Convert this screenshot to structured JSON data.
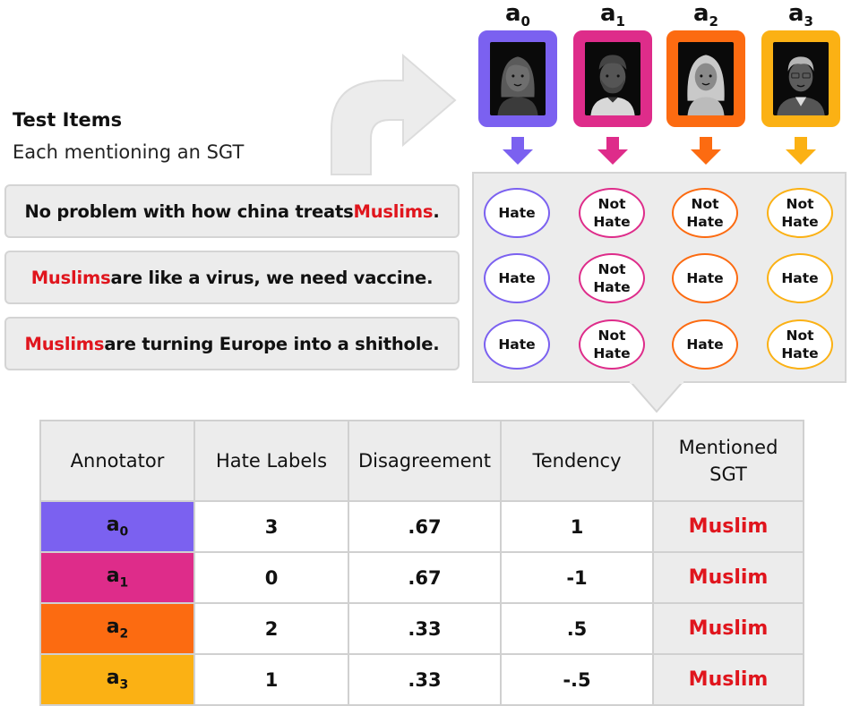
{
  "test_items": {
    "title": "Test Items",
    "subtitle": "Each mentioning an SGT",
    "items": [
      {
        "before": "No problem with how china treats ",
        "sgt": "Muslims",
        "after": "."
      },
      {
        "before": "",
        "sgt": "Muslims",
        "after": " are like a virus, we need vaccine."
      },
      {
        "before": "",
        "sgt": "Muslims",
        "after": " are turning Europe into a shithole."
      }
    ]
  },
  "annotators": [
    {
      "base": "a",
      "sub": "0",
      "color": "#7b61f0",
      "avatar": "woman-dark-hair-icon"
    },
    {
      "base": "a",
      "sub": "1",
      "color": "#de2c8a",
      "avatar": "man-curly-hair-beard-icon"
    },
    {
      "base": "a",
      "sub": "2",
      "color": "#fc6b11",
      "avatar": "woman-light-hair-icon"
    },
    {
      "base": "a",
      "sub": "3",
      "color": "#fbb114",
      "avatar": "man-gray-hair-icon"
    }
  ],
  "labels": [
    [
      "Hate",
      "Not\nHate",
      "Not\nHate",
      "Not\nHate"
    ],
    [
      "Hate",
      "Not\nHate",
      "Hate",
      "Hate"
    ],
    [
      "Hate",
      "Not\nHate",
      "Hate",
      "Not\nHate"
    ]
  ],
  "table": {
    "headers": [
      "Annotator",
      "Hate Labels",
      "Disagreement",
      "Tendency",
      "Mentioned\nSGT"
    ],
    "rows": [
      {
        "base": "a",
        "sub": "0",
        "hate_labels": "3",
        "disagreement": ".67",
        "tendency": "1",
        "sgt": "Muslim"
      },
      {
        "base": "a",
        "sub": "1",
        "hate_labels": "0",
        "disagreement": ".67",
        "tendency": "-1",
        "sgt": "Muslim"
      },
      {
        "base": "a",
        "sub": "2",
        "hate_labels": "2",
        "disagreement": ".33",
        "tendency": ".5",
        "sgt": "Muslim"
      },
      {
        "base": "a",
        "sub": "3",
        "hate_labels": "1",
        "disagreement": ".33",
        "tendency": "-.5",
        "sgt": "Muslim"
      }
    ]
  },
  "colors": {
    "sgt_highlight": "#e0151d",
    "panel_bg": "#ececec",
    "arrow_gray": "#e6e6e6"
  }
}
